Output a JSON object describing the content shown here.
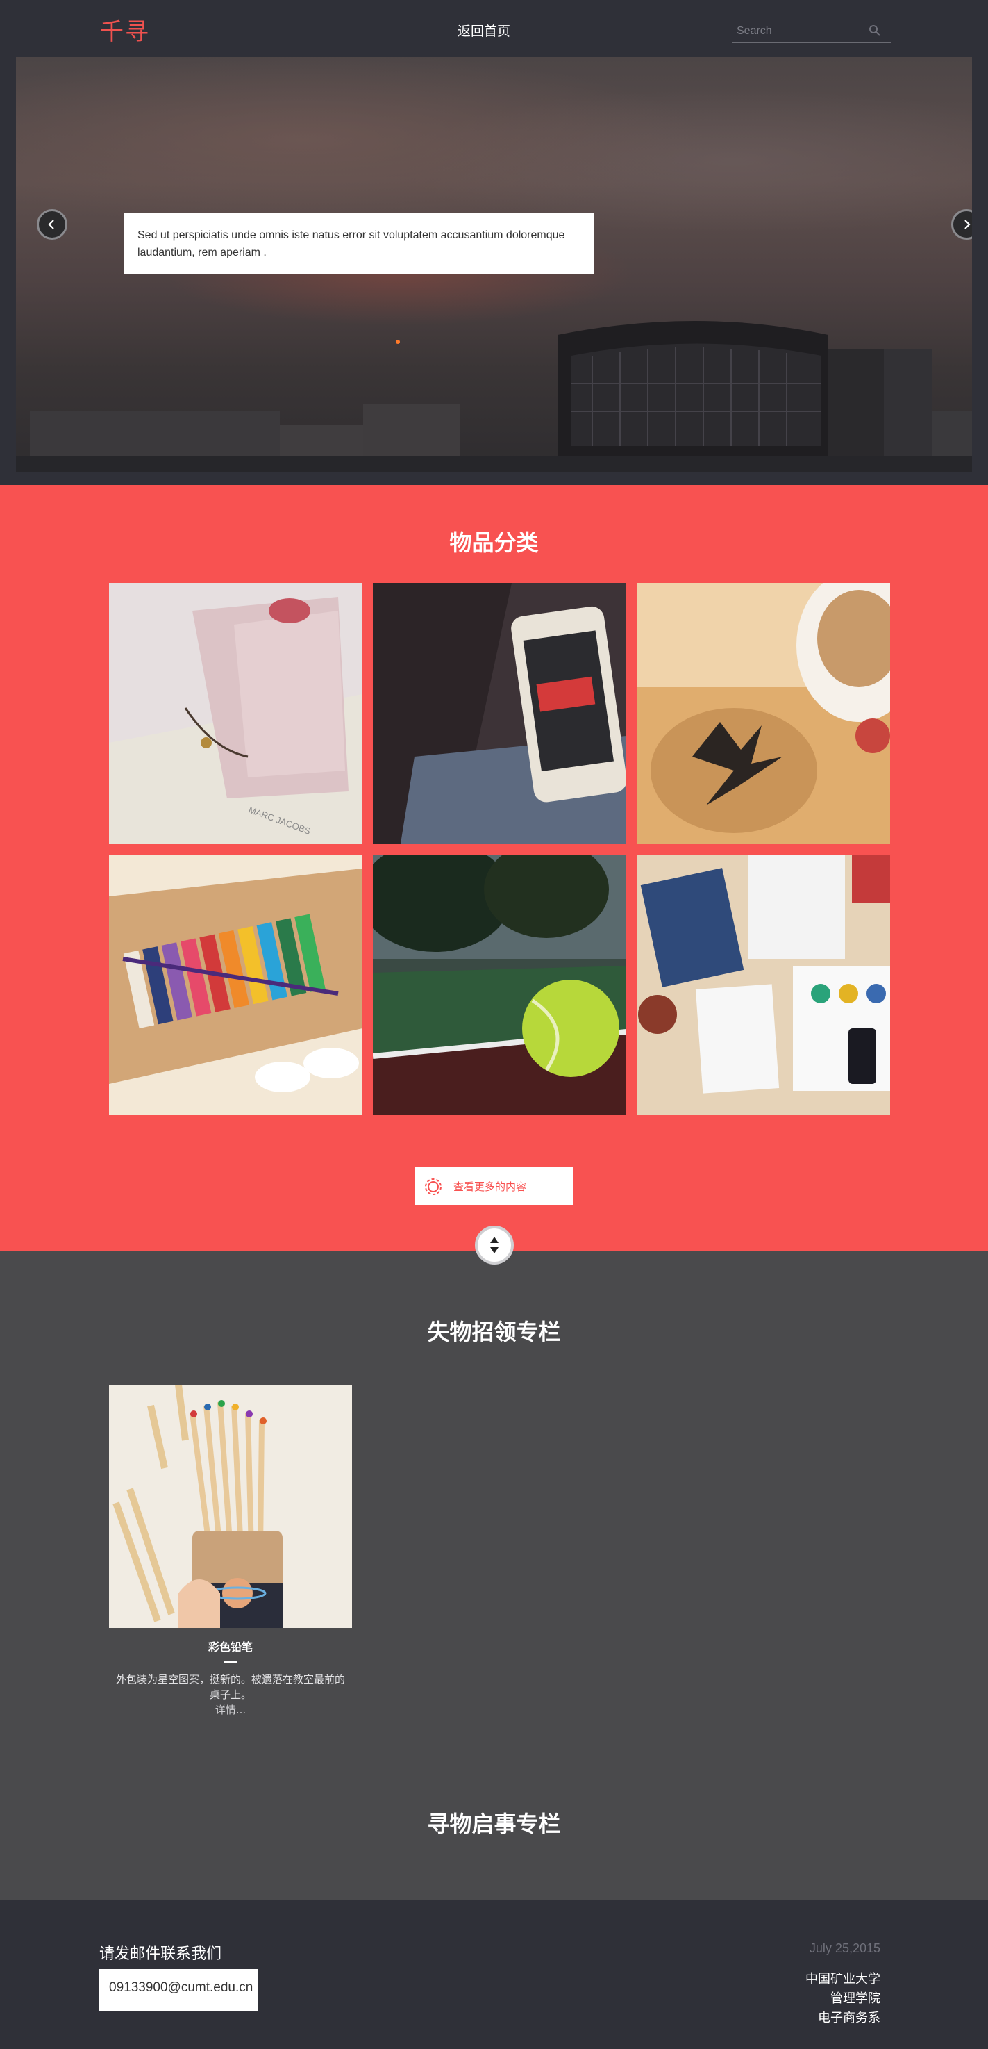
{
  "header": {
    "logo": "千寻",
    "nav_home": "返回首页",
    "search_placeholder": "Search"
  },
  "hero": {
    "caption": "Sed ut perspiciatis unde omnis iste natus error sit voluptatem accusantium doloremque laudantium, rem aperiam ."
  },
  "categories": {
    "title": "物品分类",
    "tiles": [
      {
        "icon": "wallet-photo"
      },
      {
        "icon": "phone-photo"
      },
      {
        "icon": "coaster-photo"
      },
      {
        "icon": "paints-photo"
      },
      {
        "icon": "tennis-ball-photo"
      },
      {
        "icon": "desk-photo"
      }
    ],
    "more_button": "查看更多的内容"
  },
  "lost": {
    "title": "失物招领专栏",
    "items": [
      {
        "name": "彩色铅笔",
        "desc": "外包装为星空图案，挺新的。被遗落在教室最前的桌子上。",
        "more": "详情..."
      }
    ]
  },
  "seek": {
    "title": "寻物启事专栏"
  },
  "footer": {
    "contact_title": "请发邮件联系我们",
    "email": "09133900@cumt.edu.cn",
    "date": "July 25,2015",
    "org_line1": "中国矿业大学",
    "org_line2": "管理学院",
    "org_line3": "电子商务系"
  },
  "colors": {
    "accent": "#f85251",
    "header_bg": "#2f3038",
    "section_gray": "#4a4a4c"
  }
}
